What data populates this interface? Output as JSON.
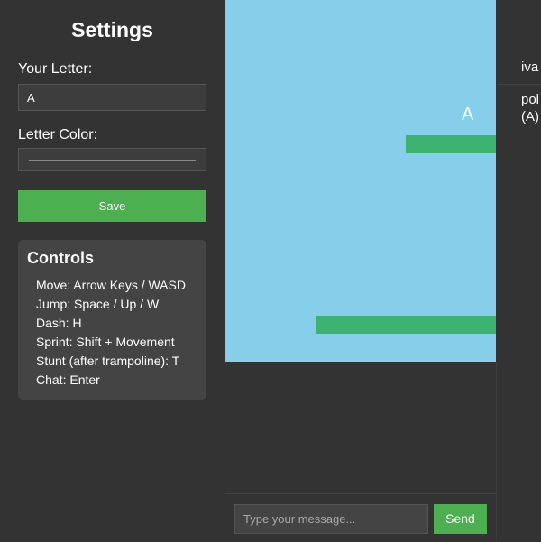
{
  "settings": {
    "title": "Settings",
    "letter_label": "Your Letter:",
    "letter_value": "A",
    "color_label": "Letter Color:",
    "save_label": "Save"
  },
  "controls": {
    "title": "Controls",
    "items": [
      "Move: Arrow Keys / WASD",
      "Jump: Space / Up / W",
      "Dash: H",
      "Sprint: Shift + Movement",
      "Stunt (after trampoline): T",
      "Chat: Enter"
    ]
  },
  "game": {
    "player_letter": "A",
    "player_color": "#ffffff",
    "sky_color": "#87ceeb",
    "platform_color": "#3cb371"
  },
  "chat": {
    "placeholder": "Type your message...",
    "send_label": "Send"
  },
  "players": {
    "rows": [
      {
        "line1": "iva",
        "line2": ""
      },
      {
        "line1": "pol",
        "line2": "(A)"
      }
    ]
  },
  "colors": {
    "accent": "#4caf50",
    "background": "#333333",
    "panel": "#444444"
  }
}
